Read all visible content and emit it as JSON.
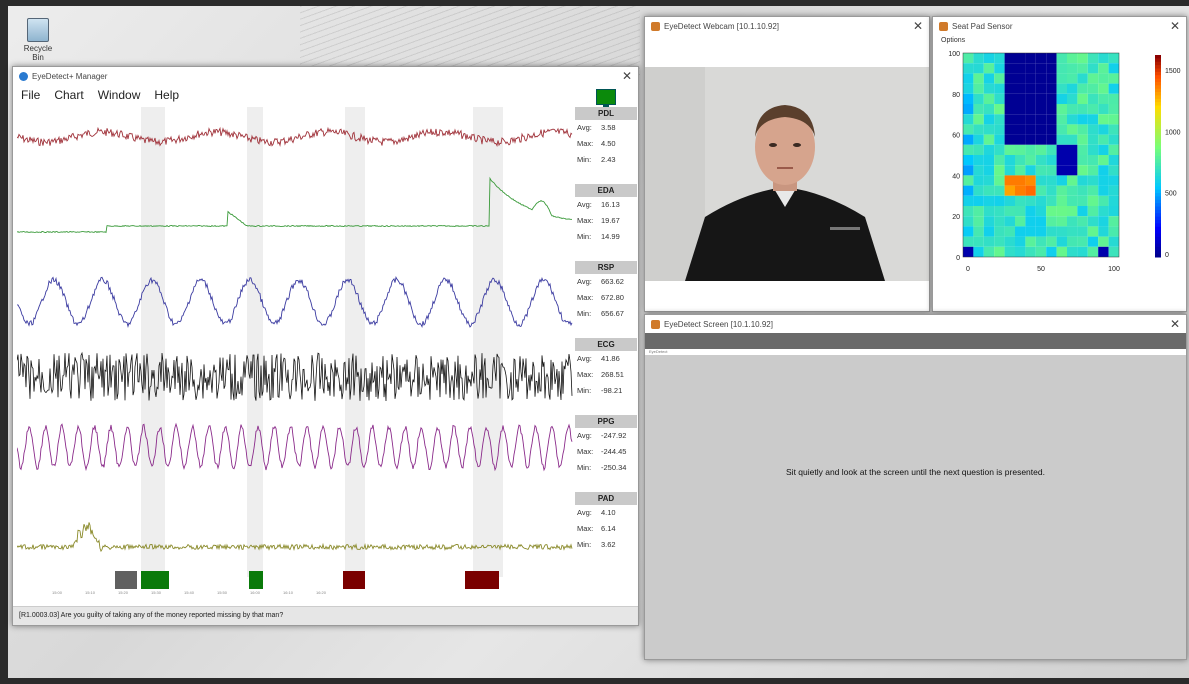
{
  "desktop": {
    "recycle_label": "Recycle Bin"
  },
  "manager": {
    "title": "EyeDetect+ Manager",
    "menu": [
      "File",
      "Chart",
      "Window",
      "Help"
    ],
    "question": "[R1.0003.03] Are you guilty of taking any of the money reported missing by that man?",
    "time_ticks": [
      "15:00",
      "15:05",
      "15:10",
      "15:15",
      "15:20",
      "15:25",
      "15:30",
      "15:35",
      "15:40",
      "15:45",
      "15:50",
      "15:55",
      "16:00",
      "16:05",
      "16:10",
      "16:15",
      "16:20"
    ],
    "channels": [
      {
        "name": "PDL",
        "avg": "3.58",
        "max": "4.50",
        "min": "2.43",
        "color": "#a0323a"
      },
      {
        "name": "EDA",
        "avg": "16.13",
        "max": "19.67",
        "min": "14.99",
        "color": "#3a9a3a"
      },
      {
        "name": "RSP",
        "avg": "663.62",
        "max": "672.80",
        "min": "656.67",
        "color": "#3a3aa0"
      },
      {
        "name": "ECG",
        "avg": "41.86",
        "max": "268.51",
        "min": "-98.21",
        "color": "#111111"
      },
      {
        "name": "PPG",
        "avg": "-247.92",
        "max": "-244.45",
        "min": "-250.34",
        "color": "#8a2a8a"
      },
      {
        "name": "PAD",
        "avg": "4.10",
        "max": "6.14",
        "min": "3.62",
        "color": "#8a8a2a"
      }
    ],
    "labels": {
      "avg": "Avg:",
      "max": "Max:",
      "min": "Min:"
    },
    "markers": [
      {
        "color": "#606060"
      },
      {
        "color": "#0a7a0a"
      },
      {
        "color": "#0a7a0a"
      },
      {
        "color": "#7a0000"
      },
      {
        "color": "#7a0000"
      }
    ]
  },
  "webcam": {
    "title": "EyeDetect Webcam [10.1.10.92]"
  },
  "seatpad": {
    "title": "Seat Pad Sensor",
    "options": "Options",
    "y_ticks": [
      "100",
      "80",
      "60",
      "40",
      "20",
      "0"
    ],
    "x_ticks": [
      "0",
      "50",
      "100"
    ],
    "colorbar_ticks": [
      "1500",
      "1000",
      "500",
      "0"
    ]
  },
  "screen": {
    "title": "EyeDetect Screen [10.1.10.92]",
    "inner_title": "EyeDetect",
    "prompt": "Sit quietly and look at the screen until the next question is presented."
  }
}
